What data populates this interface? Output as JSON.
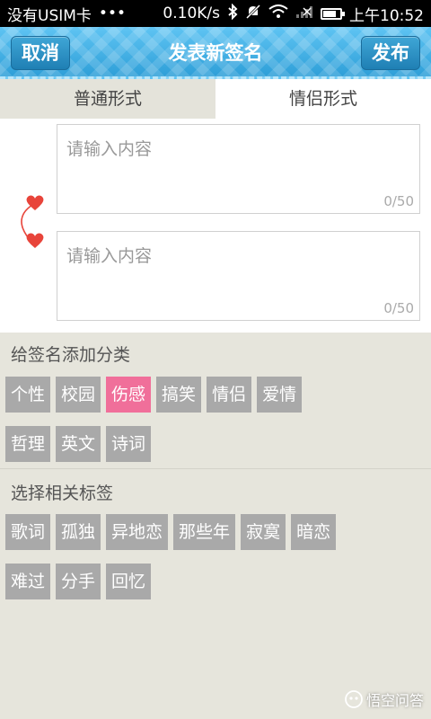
{
  "status_bar": {
    "carrier": "没有USIM卡",
    "dots": "•••",
    "speed": "0.10K/s",
    "time": "上午10:52"
  },
  "nav": {
    "cancel_label": "取消",
    "title": "发表新签名",
    "publish_label": "发布"
  },
  "tabs": [
    {
      "label": "普通形式",
      "selected": false
    },
    {
      "label": "情侣形式",
      "selected": true
    }
  ],
  "inputs": [
    {
      "placeholder": "请输入内容",
      "value": "",
      "counter": "0/50"
    },
    {
      "placeholder": "请输入内容",
      "value": "",
      "counter": "0/50"
    }
  ],
  "category_section": {
    "title": "给签名添加分类",
    "row1": [
      "个性",
      "校园",
      "伤感",
      "搞笑",
      "情侣",
      "爱情"
    ],
    "row2": [
      "哲理",
      "英文",
      "诗词"
    ],
    "selected": "伤感"
  },
  "tag_section": {
    "title": "选择相关标签",
    "row1": [
      "歌词",
      "孤独",
      "异地恋",
      "那些年",
      "寂寞",
      "暗恋"
    ],
    "row2": [
      "难过",
      "分手",
      "回忆"
    ]
  },
  "watermark": {
    "text": "悟空问答"
  },
  "colors": {
    "nav_blue": "#35aee6",
    "chip_gray": "#a9a9a9",
    "chip_selected": "#f06f9a",
    "heart_red": "#e8443a",
    "page_bg": "#e6e5dc"
  }
}
